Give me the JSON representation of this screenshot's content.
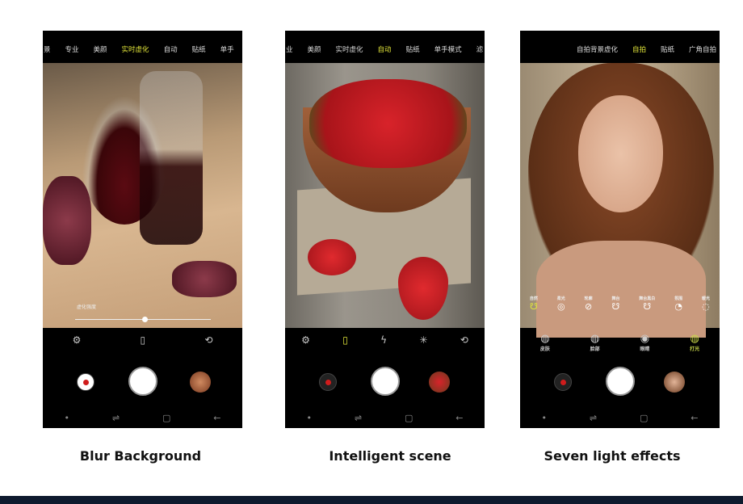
{
  "panels": [
    {
      "modes": [
        "景",
        "专业",
        "美颜",
        "实时虚化",
        "自动",
        "贴纸",
        "单手"
      ],
      "active": "实时虚化",
      "slider_label": "虚化强度",
      "caption": "Blur Background"
    },
    {
      "modes": [
        "业",
        "美颜",
        "实时虚化",
        "自动",
        "贴纸",
        "单手模式",
        "滤"
      ],
      "active": "自动",
      "caption": "Intelligent scene"
    },
    {
      "modes": [
        "自拍背景虚化",
        "自拍",
        "贴纸",
        "广角自拍"
      ],
      "active": "自拍",
      "light_effects": [
        "自然",
        "柔光",
        "轮廓",
        "舞台",
        "舞台黑白",
        "氛围",
        "暖光"
      ],
      "beauty_options": [
        "皮肤",
        "脸部",
        "眼睛",
        "打光"
      ],
      "caption": "Seven light effects"
    }
  ],
  "colors": {
    "accent": "#e4e83a",
    "record": "#d01c1c",
    "footer": "#0e1a2e"
  }
}
